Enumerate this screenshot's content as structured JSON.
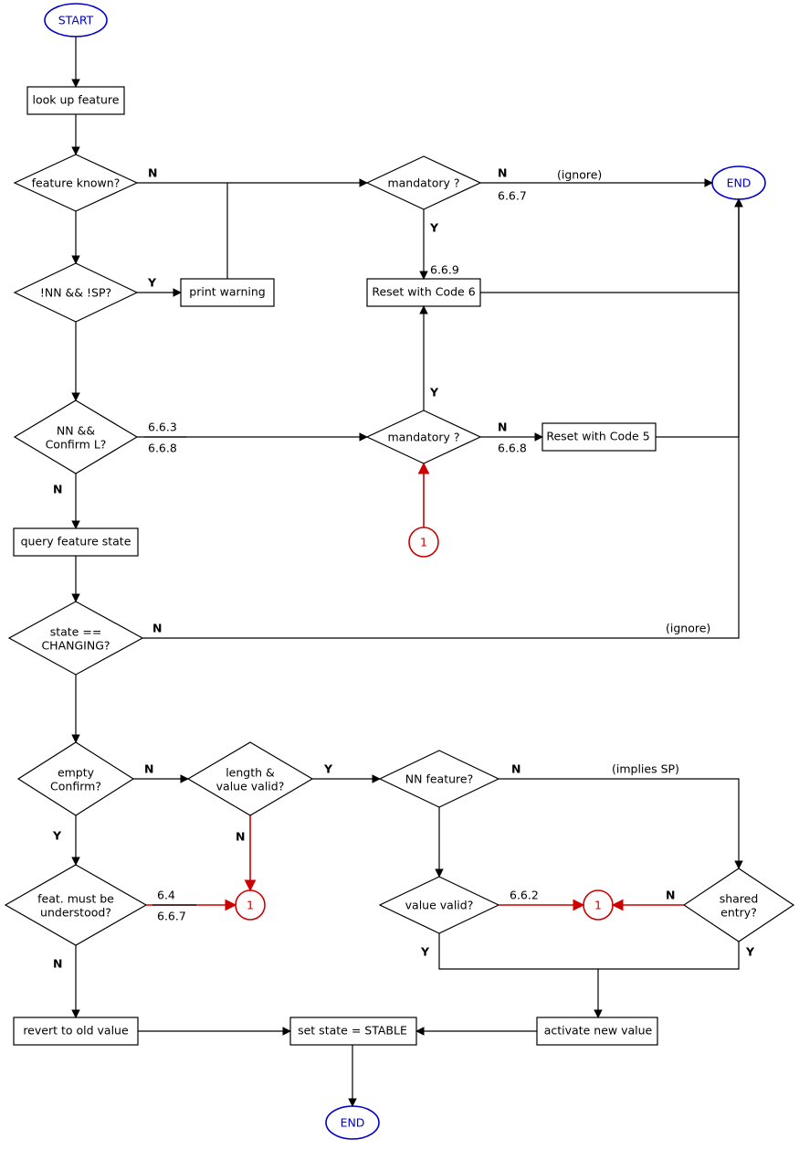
{
  "nodes": {
    "start": "START",
    "lookup": "look up feature",
    "featknown": "feature known?",
    "nn_sp": "!NN  && !SP?",
    "printwarn": "print warning",
    "mandatory1": "mandatory ?",
    "reset6": "Reset with Code 6",
    "nnconfirm1": "NN  &&",
    "nnconfirm2": "Confirm L?",
    "mandatory2": "mandatory ?",
    "reset5": "Reset with Code 5",
    "queryfs": "query feature state",
    "statechg1": "state ==",
    "statechg2": "CHANGING?",
    "emptycf1": "empty",
    "emptycf2": "Confirm?",
    "lenval1": "length &",
    "lenval2": "value valid?",
    "nnfeat": "NN feature?",
    "featmust1": "feat. must  be",
    "featmust2": "understood?",
    "valvalid": "value valid?",
    "shared": "shared",
    "shared2": "entry?",
    "revert": "revert to old value",
    "setstable": "set state = STABLE",
    "activate": "activate new value",
    "end1": "END",
    "end2": "END",
    "conn1": "1",
    "conn2": "1",
    "conn3": "1",
    "conn4": "1"
  },
  "labels": {
    "Y": "Y",
    "N": "N",
    "ignore": "(ignore)",
    "impliesSP": "(implies SP)",
    "r667": "6.6.7",
    "r669": "6.6.9",
    "r663": "6.6.3",
    "r668": "6.6.8",
    "r64": "6.4",
    "r662": "6.6.2"
  }
}
